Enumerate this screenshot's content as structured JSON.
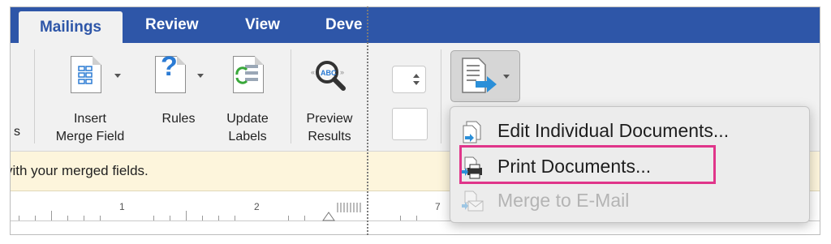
{
  "tabs": [
    {
      "label": "Mailings",
      "active": true
    },
    {
      "label": "Review",
      "active": false
    },
    {
      "label": "View",
      "active": false
    },
    {
      "label": "Deve",
      "active": false
    }
  ],
  "ribbon": {
    "partial_label": "s",
    "insert_merge_field": {
      "line1": "Insert",
      "line2": "Merge Field"
    },
    "rules": {
      "line1": "Rules"
    },
    "update_labels": {
      "line1": "Update",
      "line2": "Labels"
    },
    "preview_results": {
      "line1": "Preview",
      "line2": "Results"
    }
  },
  "message_bar": {
    "text": "vith your merged fields."
  },
  "ruler": {
    "labels": [
      "1",
      "2",
      "7"
    ]
  },
  "menu": {
    "items": [
      {
        "label": "Edit Individual Documents...",
        "enabled": true
      },
      {
        "label": "Print Documents...",
        "enabled": true,
        "highlighted": true
      },
      {
        "label": "Merge to E-Mail",
        "enabled": false
      }
    ]
  },
  "colors": {
    "tab_bar": "#2e56a8",
    "highlight": "#e0358a",
    "message_bar": "#fdf5dc"
  }
}
